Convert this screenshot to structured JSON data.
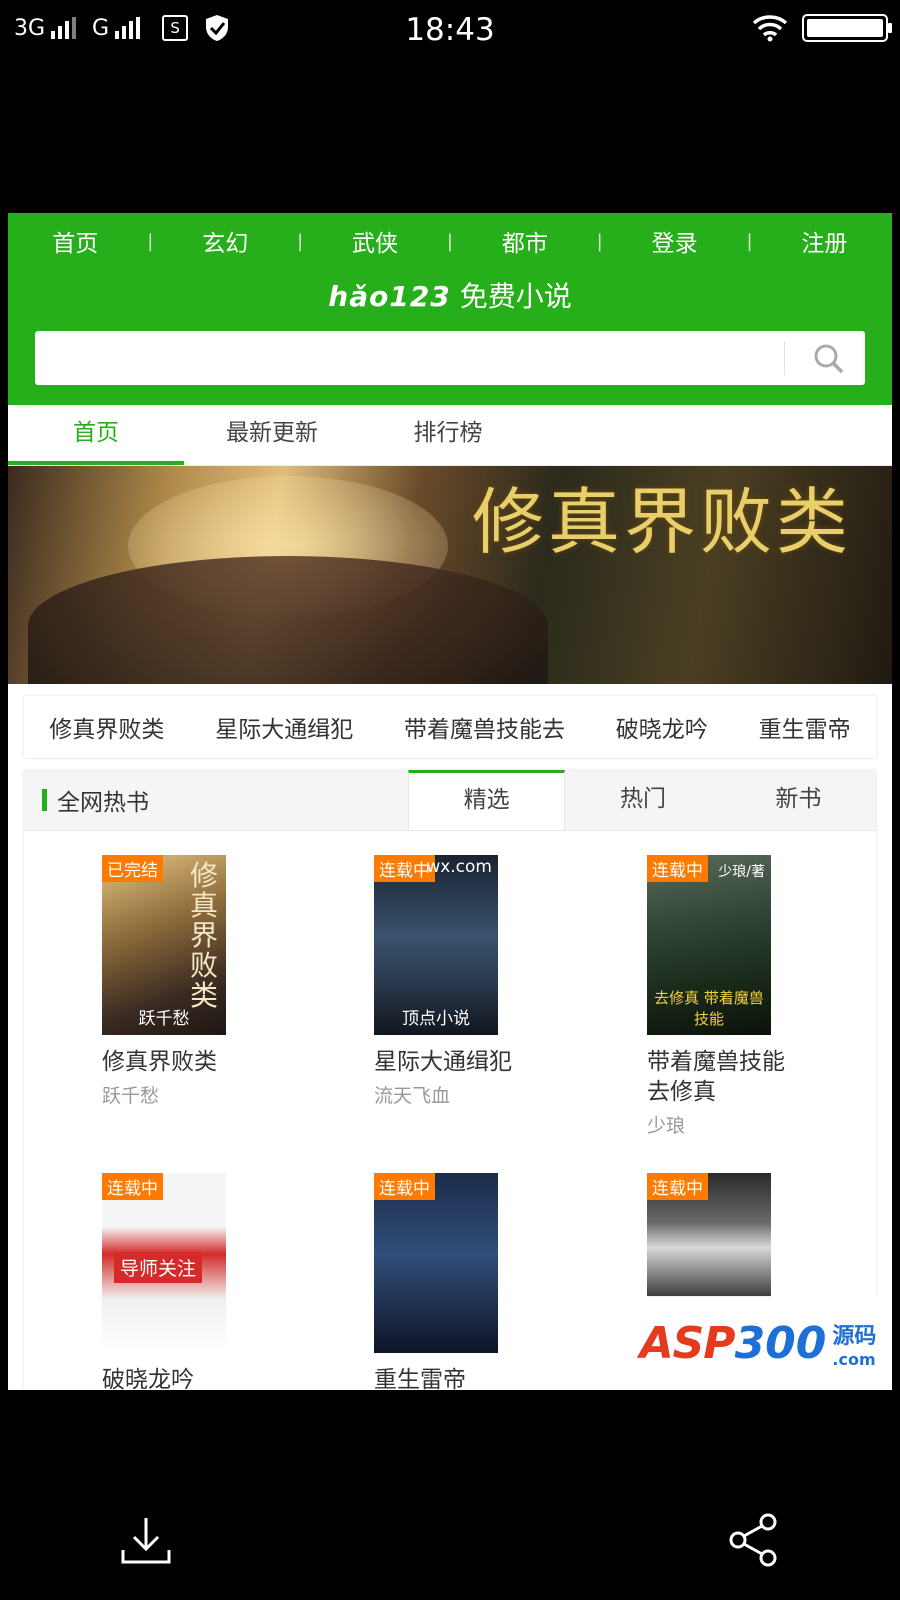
{
  "status_bar": {
    "network1": "3G",
    "network2": "G",
    "sim_icon_text": "S",
    "time": "18:43"
  },
  "top_nav": [
    "首页",
    "玄幻",
    "武侠",
    "都市",
    "登录",
    "注册"
  ],
  "logo": {
    "brand": "hǎo123",
    "tagline": "免费小说"
  },
  "search": {
    "placeholder": "",
    "value": ""
  },
  "tabs": [
    "首页",
    "最新更新",
    "排行榜"
  ],
  "banner": {
    "title_glyphs": "修真界败类"
  },
  "quick_links": [
    "修真界败类",
    "星际大通缉犯",
    "带着魔兽技能去",
    "破晓龙吟",
    "重生雷帝"
  ],
  "panel": {
    "title": "全网热书",
    "tabs": [
      "精选",
      "热门",
      "新书"
    ]
  },
  "books": [
    {
      "name": "修真界败类",
      "author": "跃千愁",
      "badge": "已完结",
      "cover_text": "跃千愁",
      "cover_big": "修真界败类"
    },
    {
      "name": "星际大通缉犯",
      "author": "流天飞血",
      "badge": "连载中",
      "cover_text": "顶点小说",
      "cover_top": "wx.com"
    },
    {
      "name": "带着魔兽技能去修真",
      "author": "少琅",
      "badge": "连载中",
      "cover_text": "去修真 带着魔兽技能",
      "cover_top": "少琅/著"
    },
    {
      "name": "破晓龙吟",
      "author": "",
      "badge": "连载中",
      "cover_text": "导师关注",
      "cover_top": ""
    },
    {
      "name": "重生雷帝",
      "author": "",
      "badge": "连载中",
      "cover_text": "",
      "cover_top": ""
    },
    {
      "name": "",
      "author": "",
      "badge": "连载中",
      "cover_text": "",
      "cover_top": ""
    }
  ],
  "watermark": {
    "brand_a": "ASP",
    "brand_b": "300",
    "cn": "源码",
    "en": ".com"
  },
  "colors": {
    "brand_green": "#27ae1b",
    "badge_orange": "#ff7a00"
  }
}
